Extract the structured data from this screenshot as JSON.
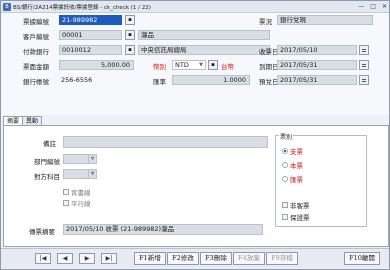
{
  "window": {
    "title": "BS/銀行/2A214票據託收/票據登錄 - ck_check (1 / 22)",
    "controls": [
      "—",
      "□",
      "✕"
    ]
  },
  "form": {
    "bill_no_label": "票據編號",
    "bill_no_value": "21-989982",
    "bill_pick_icon": "search-icon",
    "status_label": "票況",
    "status_value": "銀行兌現",
    "customer_label": "客戶編號",
    "customer_code": "00001",
    "customer_name": "瀧品",
    "pay_bank_label": "付款銀行",
    "pay_bank_code": "0010012",
    "pay_bank_name": "中央信託局總局",
    "receive_date_label": "收票日",
    "receive_date_value": "2017/05/10",
    "amount_label": "票面金額",
    "amount_value": "5,000.00",
    "currency_label": "幣別",
    "currency_value": "NTD",
    "currency_name": "台幣",
    "due_date_label": "到期日",
    "due_date_value": "2017/05/31",
    "bank_account_label": "銀行帳號",
    "bank_account_value": "256-6556",
    "rate_label": "匯率",
    "rate_value": "1.0000",
    "expect_date_label": "預兌日",
    "expect_date_value": "2017/05/31"
  },
  "tabs": [
    {
      "label": "摘要",
      "active": true
    },
    {
      "label": "異動",
      "active": false
    }
  ],
  "panel": {
    "remark_label": "備註",
    "dept_label": "部門編號",
    "account_label": "對方科目",
    "endorse_label": "背書線",
    "parallel_label": "平行線",
    "summary_label": "傳票摘要",
    "summary_value": "2017/05/10 收票 (21-989982)瀧品",
    "group_title": "票別",
    "radios": [
      {
        "label": "支票",
        "on": true
      },
      {
        "label": "本票",
        "on": false
      },
      {
        "label": "匯票",
        "on": false
      }
    ],
    "not_bill_label": "非客票",
    "guarantee_label": "保證票"
  },
  "bottom": {
    "nav": [
      "|◀",
      "◀",
      "▶",
      "▶|"
    ],
    "buttons": [
      {
        "label": "F1新增",
        "enabled": true
      },
      {
        "label": "F2修改",
        "enabled": true
      },
      {
        "label": "F3刪除",
        "enabled": true
      },
      {
        "label": "F4放棄",
        "enabled": false
      },
      {
        "label": "F9存檔",
        "enabled": false
      },
      {
        "label": "F10離開",
        "enabled": true
      }
    ]
  },
  "colors": {
    "selection": "#1f5bbd",
    "field_bg": "#d9dde4",
    "accent_red": "#d01818"
  }
}
